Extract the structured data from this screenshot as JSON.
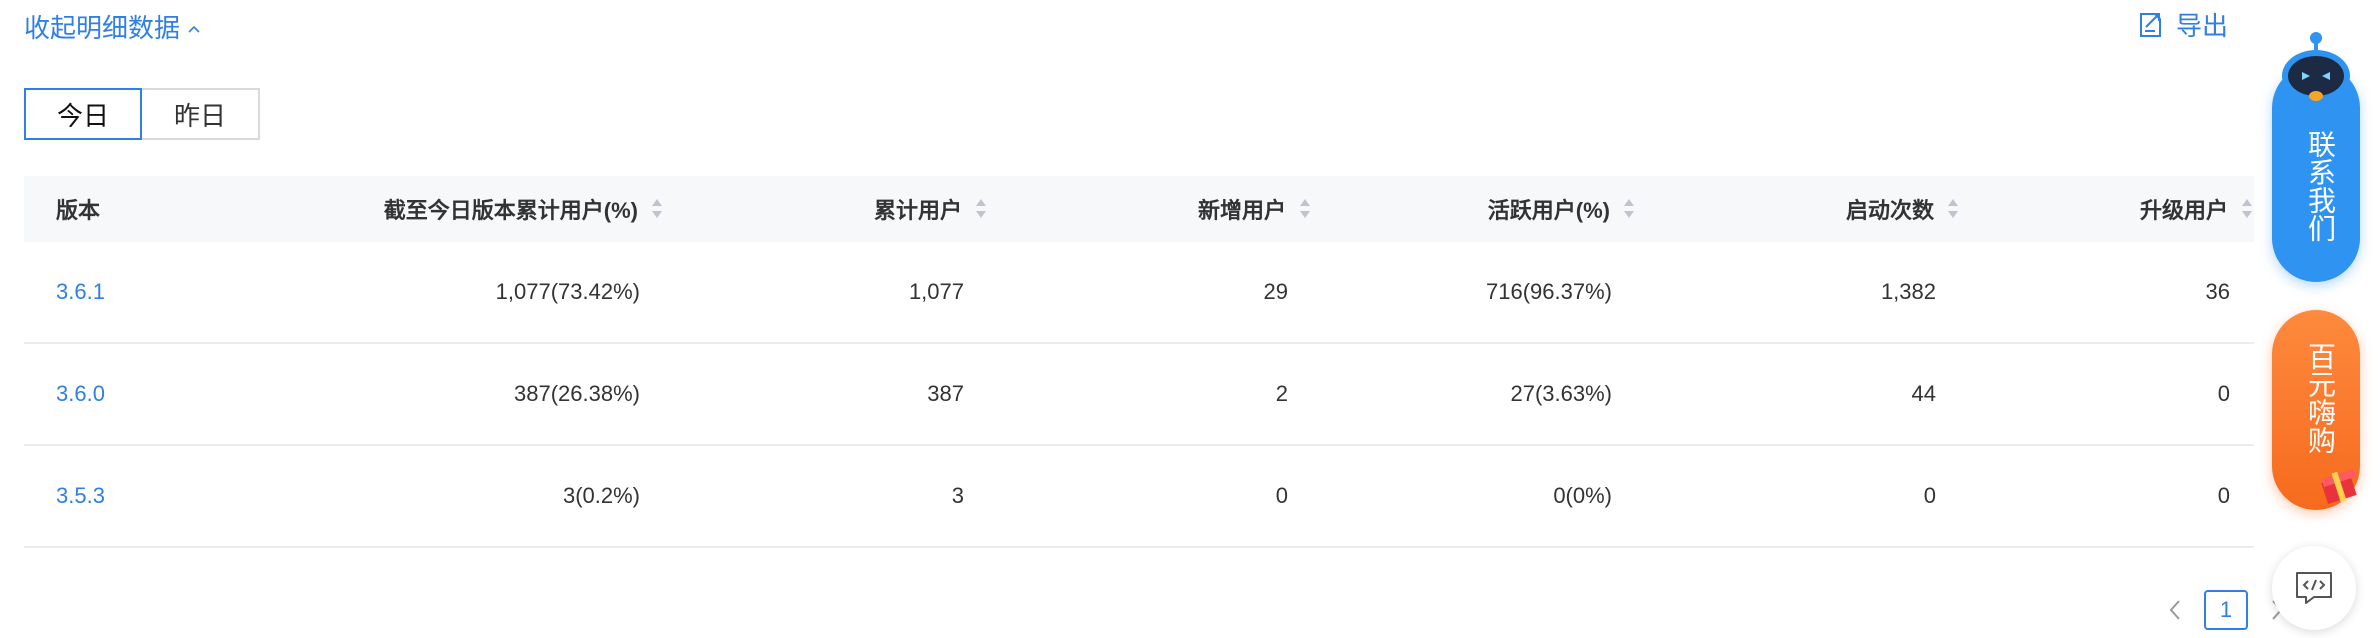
{
  "header": {
    "collapse_label": "收起明细数据",
    "export_label": "导出"
  },
  "tabs": [
    {
      "label": "今日",
      "active": true
    },
    {
      "label": "昨日",
      "active": false
    }
  ],
  "table": {
    "columns": [
      "版本",
      "截至今日版本累计用户(%)",
      "累计用户",
      "新增用户",
      "活跃用户(%)",
      "启动次数",
      "升级用户"
    ],
    "rows": [
      [
        "3.6.1",
        "1,077(73.42%)",
        "1,077",
        "29",
        "716(96.37%)",
        "1,382",
        "36"
      ],
      [
        "3.6.0",
        "387(26.38%)",
        "387",
        "2",
        "27(3.63%)",
        "44",
        "0"
      ],
      [
        "3.5.3",
        "3(0.2%)",
        "3",
        "0",
        "0(0%)",
        "0",
        "0"
      ]
    ]
  },
  "pagination": {
    "current_page": "1"
  },
  "floating": {
    "contact_label": "联系我们",
    "promo_label": "百元嗨购"
  },
  "colors": {
    "accent": "#2f7fe6",
    "header_bg": "#f7f8fa",
    "contact_bg": "#2e93f1",
    "promo_bg": "#f76a1d"
  }
}
